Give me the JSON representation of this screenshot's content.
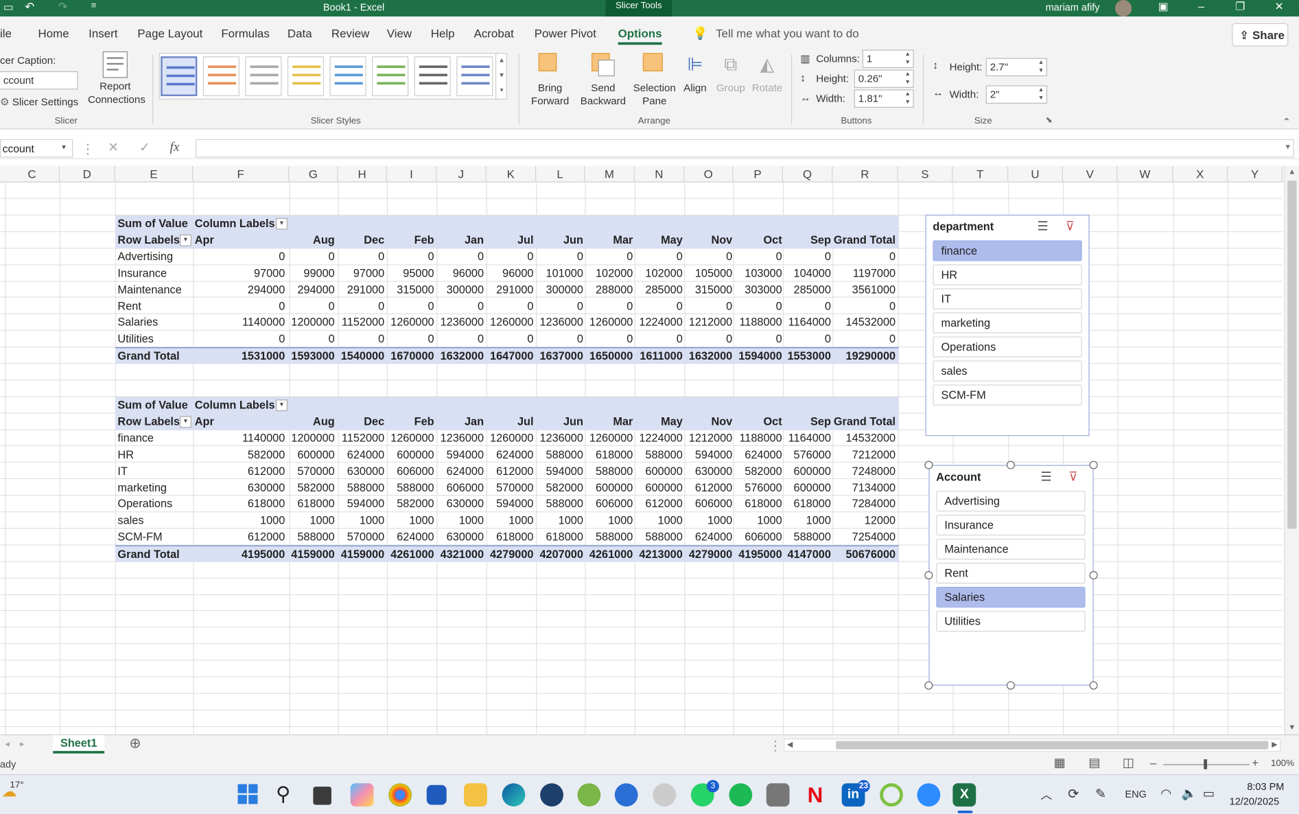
{
  "titlebar": {
    "title": "Book1  -  Excel",
    "contextual_tab": "Slicer Tools",
    "user": "mariam afify"
  },
  "tabs": [
    "ile",
    "Home",
    "Insert",
    "Page Layout",
    "Formulas",
    "Data",
    "Review",
    "View",
    "Help",
    "Acrobat",
    "Power Pivot",
    "Options"
  ],
  "tell_me": "Tell me what you want to do",
  "share": "Share",
  "ribbon": {
    "slicer": {
      "caption_label": "cer Caption:",
      "caption_value": "ccount",
      "settings": "Slicer Settings",
      "report_connections": "Report Connections",
      "group": "Slicer"
    },
    "styles_group": "Slicer Styles",
    "arrange": {
      "bring_forward": "Bring Forward",
      "send_backward": "Send Backward",
      "selection_pane": "Selection Pane",
      "align": "Align",
      "group_btn": "Group",
      "rotate": "Rotate",
      "group": "Arrange"
    },
    "buttons": {
      "columns_label": "Columns:",
      "columns_value": "1",
      "height_label": "Height:",
      "height_value": "0.26\"",
      "width_label": "Width:",
      "width_value": "1.81\"",
      "group": "Buttons"
    },
    "size": {
      "height_label": "Height:",
      "height_value": "2.7\"",
      "width_label": "Width:",
      "width_value": "2\"",
      "group": "Size"
    }
  },
  "formula_bar": {
    "name_box": "ccount",
    "fx": "fx",
    "formula": ""
  },
  "columns": [
    "C",
    "D",
    "E",
    "F",
    "G",
    "H",
    "I",
    "J",
    "K",
    "L",
    "M",
    "N",
    "O",
    "P",
    "Q",
    "R",
    "S",
    "T",
    "U",
    "V",
    "W",
    "X",
    "Y"
  ],
  "pivot1": {
    "sum_label": "Sum of Value",
    "col_labels": "Column Labels",
    "row_labels": "Row Labels",
    "months": [
      "Apr",
      "Aug",
      "Dec",
      "Feb",
      "Jan",
      "Jul",
      "Jun",
      "Mar",
      "May",
      "Nov",
      "Oct",
      "Sep",
      "Grand Total"
    ],
    "rows": [
      {
        "label": "Advertising",
        "values": [
          "0",
          "0",
          "0",
          "0",
          "0",
          "0",
          "0",
          "0",
          "0",
          "0",
          "0",
          "0",
          "0"
        ]
      },
      {
        "label": "Insurance",
        "values": [
          "97000",
          "99000",
          "97000",
          "95000",
          "96000",
          "96000",
          "101000",
          "102000",
          "102000",
          "105000",
          "103000",
          "104000",
          "1197000"
        ]
      },
      {
        "label": "Maintenance",
        "values": [
          "294000",
          "294000",
          "291000",
          "315000",
          "300000",
          "291000",
          "300000",
          "288000",
          "285000",
          "315000",
          "303000",
          "285000",
          "3561000"
        ]
      },
      {
        "label": "Rent",
        "values": [
          "0",
          "0",
          "0",
          "0",
          "0",
          "0",
          "0",
          "0",
          "0",
          "0",
          "0",
          "0",
          "0"
        ]
      },
      {
        "label": "Salaries",
        "values": [
          "1140000",
          "1200000",
          "1152000",
          "1260000",
          "1236000",
          "1260000",
          "1236000",
          "1260000",
          "1224000",
          "1212000",
          "1188000",
          "1164000",
          "14532000"
        ]
      },
      {
        "label": "Utilities",
        "values": [
          "0",
          "0",
          "0",
          "0",
          "0",
          "0",
          "0",
          "0",
          "0",
          "0",
          "0",
          "0",
          "0"
        ]
      }
    ],
    "total": {
      "label": "Grand Total",
      "values": [
        "1531000",
        "1593000",
        "1540000",
        "1670000",
        "1632000",
        "1647000",
        "1637000",
        "1650000",
        "1611000",
        "1632000",
        "1594000",
        "1553000",
        "19290000"
      ]
    }
  },
  "pivot2": {
    "sum_label": "Sum of Value",
    "col_labels": "Column Labels",
    "row_labels": "Row Labels",
    "months": [
      "Apr",
      "Aug",
      "Dec",
      "Feb",
      "Jan",
      "Jul",
      "Jun",
      "Mar",
      "May",
      "Nov",
      "Oct",
      "Sep",
      "Grand Total"
    ],
    "rows": [
      {
        "label": "finance",
        "values": [
          "1140000",
          "1200000",
          "1152000",
          "1260000",
          "1236000",
          "1260000",
          "1236000",
          "1260000",
          "1224000",
          "1212000",
          "1188000",
          "1164000",
          "14532000"
        ]
      },
      {
        "label": "HR",
        "values": [
          "582000",
          "600000",
          "624000",
          "600000",
          "594000",
          "624000",
          "588000",
          "618000",
          "588000",
          "594000",
          "624000",
          "576000",
          "7212000"
        ]
      },
      {
        "label": "IT",
        "values": [
          "612000",
          "570000",
          "630000",
          "606000",
          "624000",
          "612000",
          "594000",
          "588000",
          "600000",
          "630000",
          "582000",
          "600000",
          "7248000"
        ]
      },
      {
        "label": "marketing",
        "values": [
          "630000",
          "582000",
          "588000",
          "588000",
          "606000",
          "570000",
          "582000",
          "600000",
          "600000",
          "612000",
          "576000",
          "600000",
          "7134000"
        ]
      },
      {
        "label": "Operations",
        "values": [
          "618000",
          "618000",
          "594000",
          "582000",
          "630000",
          "594000",
          "588000",
          "606000",
          "612000",
          "606000",
          "618000",
          "618000",
          "7284000"
        ]
      },
      {
        "label": "sales",
        "values": [
          "1000",
          "1000",
          "1000",
          "1000",
          "1000",
          "1000",
          "1000",
          "1000",
          "1000",
          "1000",
          "1000",
          "1000",
          "12000"
        ]
      },
      {
        "label": "SCM-FM",
        "values": [
          "612000",
          "588000",
          "570000",
          "624000",
          "630000",
          "618000",
          "618000",
          "588000",
          "588000",
          "624000",
          "606000",
          "588000",
          "7254000"
        ]
      }
    ],
    "total": {
      "label": "Grand Total",
      "values": [
        "4195000",
        "4159000",
        "4159000",
        "4261000",
        "4321000",
        "4279000",
        "4207000",
        "4261000",
        "4213000",
        "4279000",
        "4195000",
        "4147000",
        "50676000"
      ]
    }
  },
  "slicer_department": {
    "title": "department",
    "items": [
      "finance",
      "HR",
      "IT",
      "marketing",
      "Operations",
      "sales",
      "SCM-FM"
    ],
    "selected": "finance"
  },
  "slicer_account": {
    "title": "Account",
    "items": [
      "Advertising",
      "Insurance",
      "Maintenance",
      "Rent",
      "Salaries",
      "Utilities"
    ],
    "selected": "Salaries"
  },
  "sheet_tab": "Sheet1",
  "status": {
    "ready": "ady",
    "zoom": "100%"
  },
  "taskbar": {
    "weather": "17°",
    "time": "8:03 PM",
    "date": "12/20/2025",
    "lang": "ENG",
    "whatsapp_badge": "3",
    "linkedin_badge": "23"
  },
  "colors": {
    "excel_green": "#1e7145",
    "pivot_header": "#dae0f3",
    "slicer_selected": "#aebcec"
  }
}
